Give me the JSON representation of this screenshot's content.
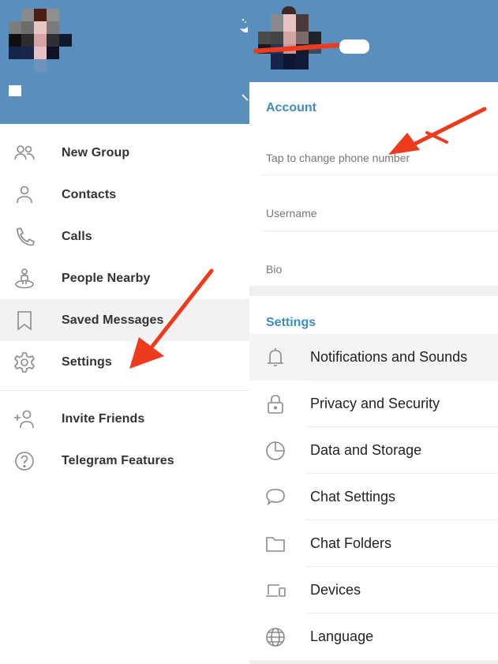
{
  "left_drawer": {
    "menu_items": [
      {
        "label": "New Group",
        "icon": "new-group-icon"
      },
      {
        "label": "Contacts",
        "icon": "contacts-icon"
      },
      {
        "label": "Calls",
        "icon": "phone-icon"
      },
      {
        "label": "People Nearby",
        "icon": "people-nearby-icon"
      },
      {
        "label": "Saved Messages",
        "icon": "bookmark-icon"
      },
      {
        "label": "Settings",
        "icon": "gear-icon"
      }
    ],
    "secondary_items": [
      {
        "label": "Invite Friends",
        "icon": "add-user-icon"
      },
      {
        "label": "Telegram Features",
        "icon": "question-icon"
      }
    ]
  },
  "settings_screen": {
    "account_section_title": "Account",
    "fields": {
      "phone": "Tap to change phone number",
      "username": "Username",
      "bio": "Bio"
    },
    "settings_section_title": "Settings",
    "items": [
      {
        "label": "Notifications and Sounds",
        "icon": "bell-icon"
      },
      {
        "label": "Privacy and Security",
        "icon": "lock-icon"
      },
      {
        "label": "Data and Storage",
        "icon": "pie-chart-icon"
      },
      {
        "label": "Chat Settings",
        "icon": "chat-bubble-icon"
      },
      {
        "label": "Chat Folders",
        "icon": "folder-icon"
      },
      {
        "label": "Devices",
        "icon": "devices-icon"
      },
      {
        "label": "Language",
        "icon": "globe-icon"
      }
    ]
  },
  "colors": {
    "header": "#5a8fbd",
    "accent": "#3d8ec4",
    "annotation_arrow": "#ee3a1d"
  }
}
